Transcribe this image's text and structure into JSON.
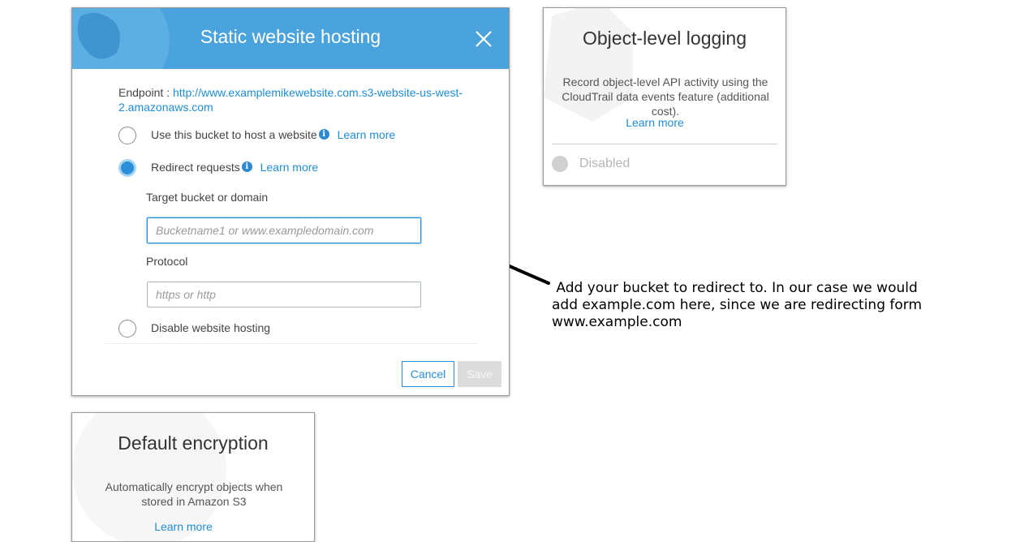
{
  "modal": {
    "title": "Static website hosting",
    "endpoint_label": "Endpoint : ",
    "endpoint_url": "http://www.examplemikewebsite.com.s3-website-us-west-2.amazonaws.com",
    "options": [
      {
        "label": "Use this bucket to host a website",
        "learn_more": "Learn more",
        "selected": false
      },
      {
        "label": "Redirect requests",
        "learn_more": "Learn more",
        "selected": true
      },
      {
        "label": "Disable website hosting",
        "selected": false
      }
    ],
    "target_label": "Target bucket or domain",
    "target_placeholder": "Bucketname1 or www.exampledomain.com",
    "target_value": "",
    "protocol_label": "Protocol",
    "protocol_placeholder": "https or http",
    "protocol_value": "",
    "cancel_label": "Cancel",
    "save_label": "Save",
    "header_color": "#4aa3dc",
    "accent_color": "#2a8fd8"
  },
  "logging_card": {
    "title": "Object-level logging",
    "description": "Record object-level API activity using the CloudTrail data events feature (additional cost).",
    "learn_more": "Learn more",
    "status": "Disabled"
  },
  "encryption_card": {
    "title": "Default encryption",
    "description": "Automatically encrypt objects when stored in Amazon S3",
    "learn_more": "Learn more"
  },
  "annotation": {
    "line1": " Add your bucket to redirect to. In our case we would",
    "line2": "add example.com here, since we are redirecting form",
    "line3": "www.example.com"
  },
  "icons": {
    "close": "close-icon",
    "info": "info-icon",
    "status": "status-dot-icon"
  }
}
